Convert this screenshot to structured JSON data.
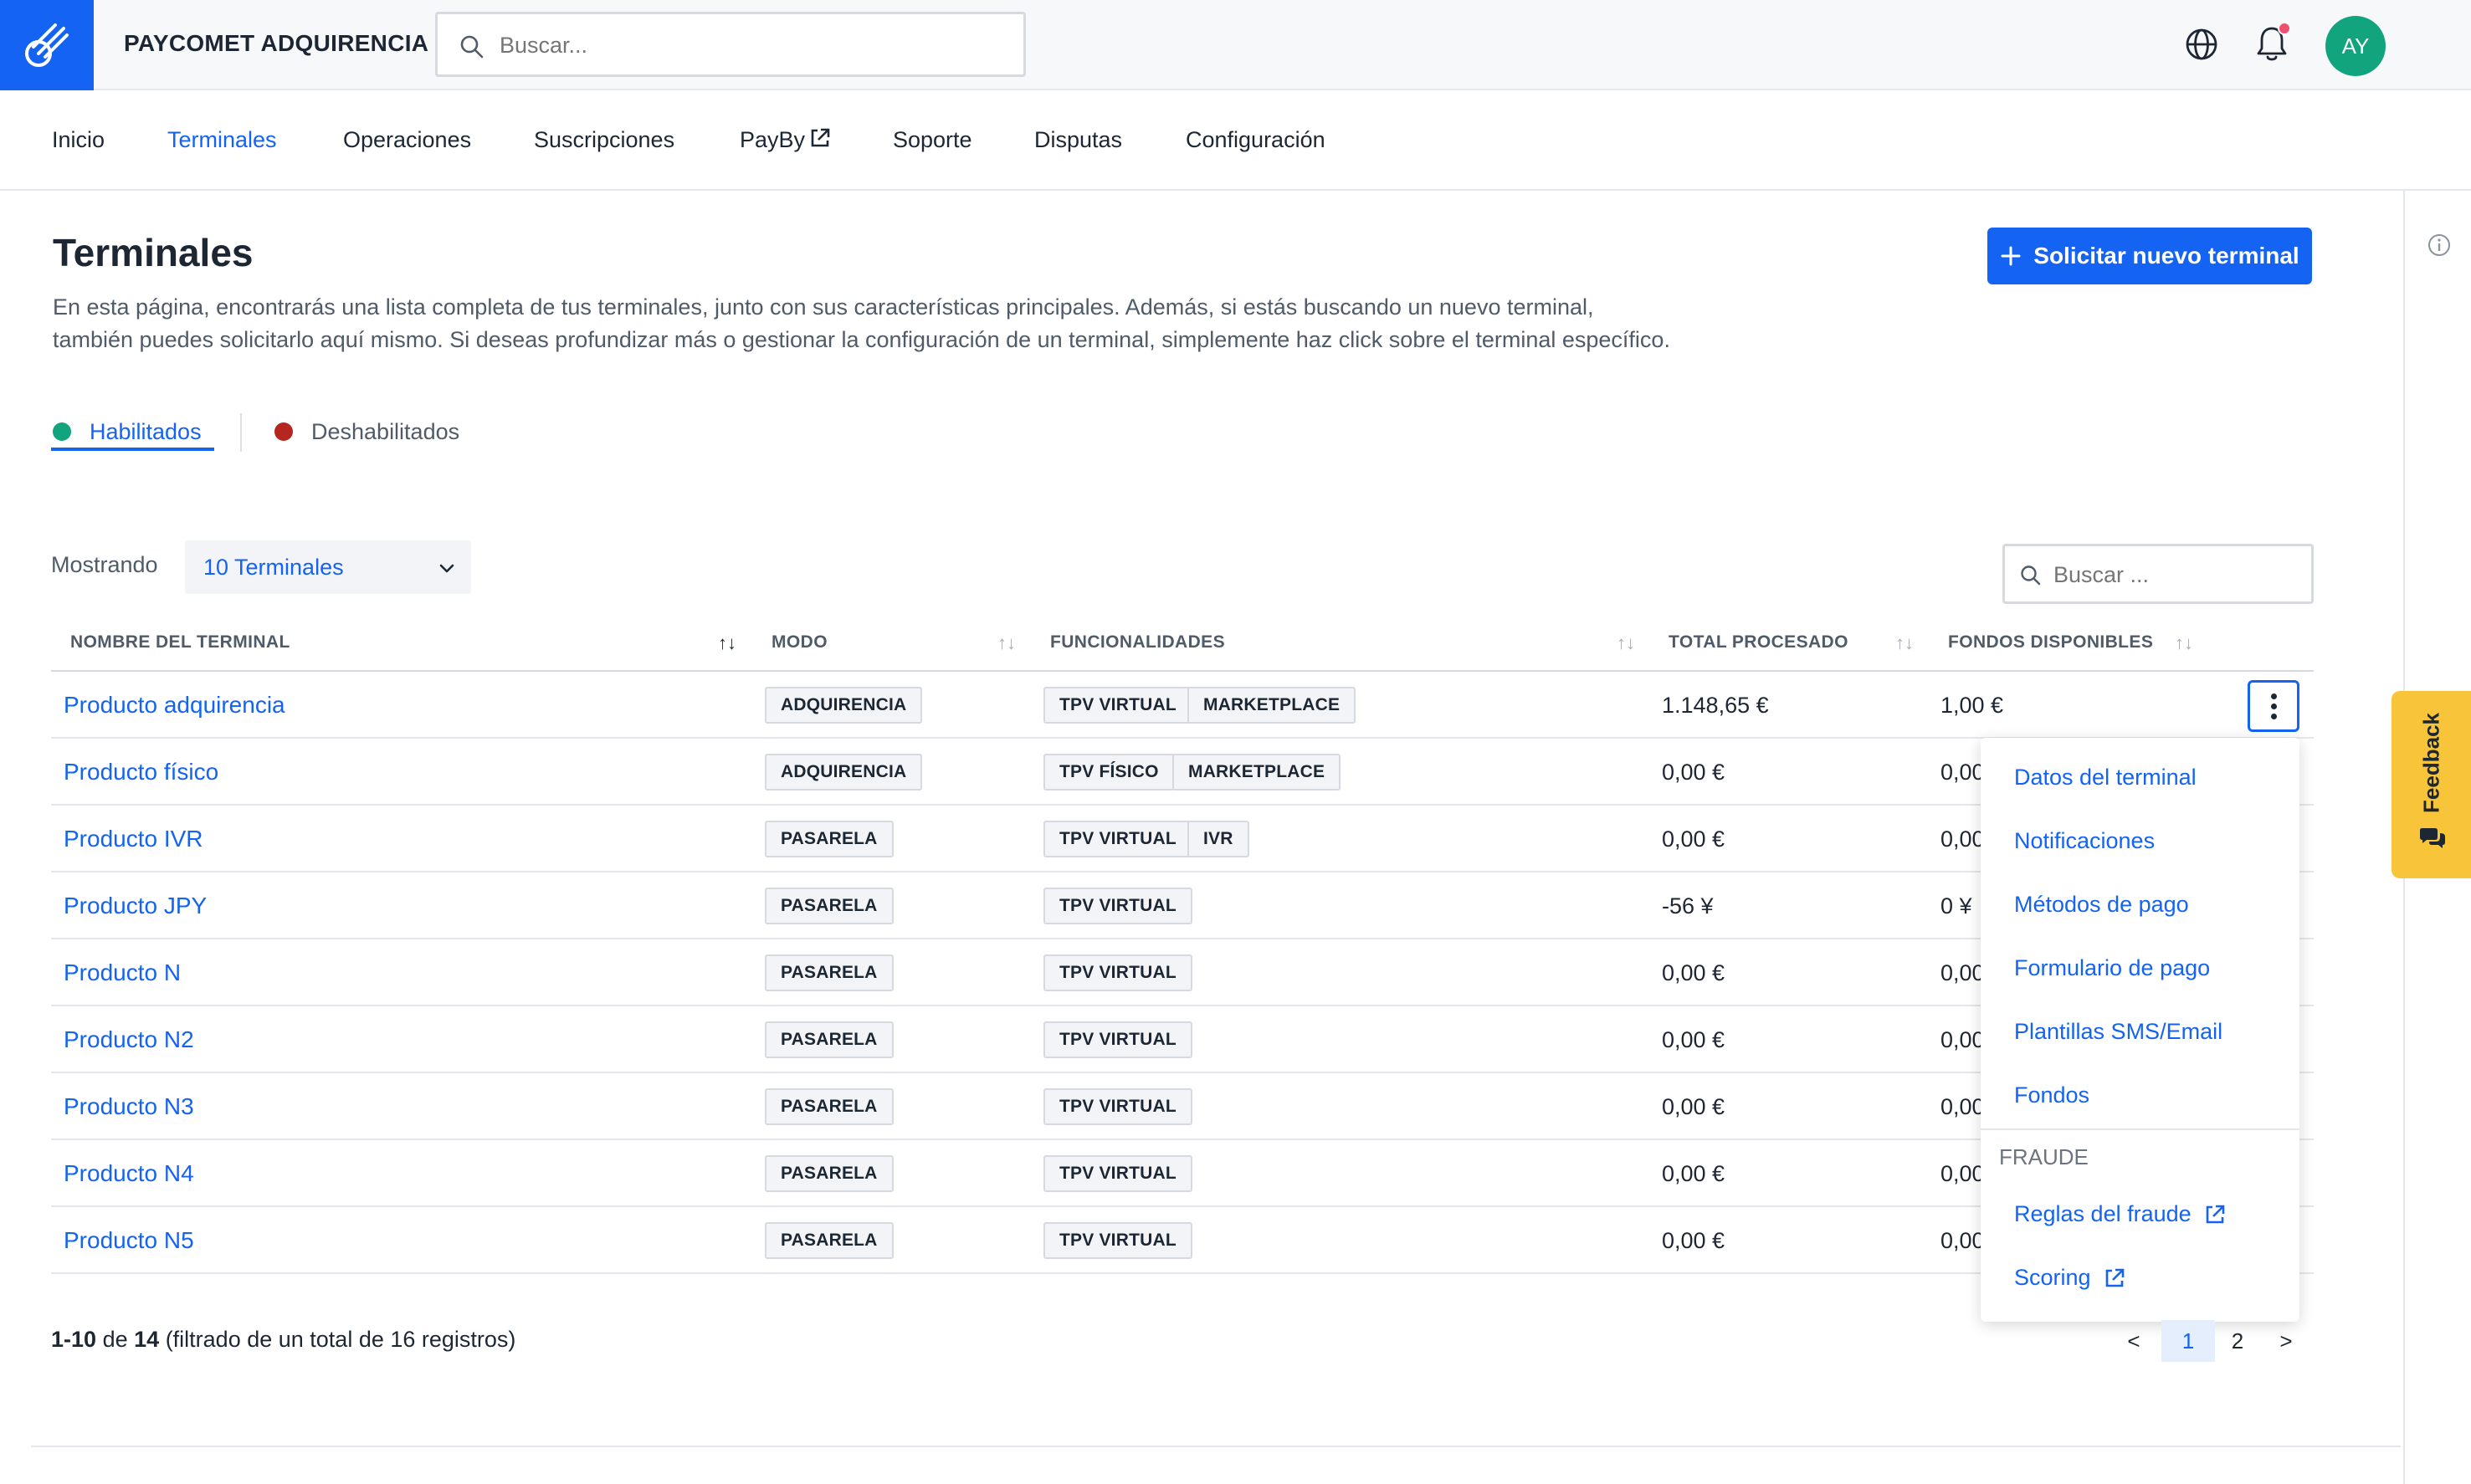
{
  "header": {
    "brand": "PAYCOMET ADQUIRENCIA",
    "search_placeholder": "Buscar...",
    "avatar_initials": "AY"
  },
  "nav": {
    "items": [
      {
        "label": "Inicio"
      },
      {
        "label": "Terminales"
      },
      {
        "label": "Operaciones"
      },
      {
        "label": "Suscripciones"
      },
      {
        "label": "PayBy"
      },
      {
        "label": "Soporte"
      },
      {
        "label": "Disputas"
      },
      {
        "label": "Configuración"
      }
    ],
    "active": "Terminales"
  },
  "page": {
    "title": "Terminales",
    "description_line1": "En esta página, encontrarás una lista completa de tus terminales, junto con sus características principales. Además, si estás buscando un nuevo terminal,",
    "description_line2": "también puedes solicitarlo aquí mismo. Si deseas profundizar más o gestionar la configuración de un terminal, simplemente haz click sobre el terminal específico.",
    "new_terminal_label": "Solicitar nuevo terminal"
  },
  "tabs": {
    "enabled_label": "Habilitados",
    "disabled_label": "Deshabilitados",
    "enabled_color": "#12a57d",
    "disabled_color": "#b4261f"
  },
  "controls": {
    "showing_label": "Mostrando",
    "showing_value": "10 Terminales",
    "table_search_placeholder": "Buscar ..."
  },
  "table": {
    "columns": [
      "NOMBRE DEL TERMINAL",
      "MODO",
      "FUNCIONALIDADES",
      "TOTAL PROCESADO",
      "FONDOS DISPONIBLES"
    ],
    "rows": [
      {
        "name": "Producto adquirencia",
        "mode": "ADQUIRENCIA",
        "features": [
          "TPV VIRTUAL",
          "MARKETPLACE"
        ],
        "total": "1.148,65 €",
        "funds": "1,00 €"
      },
      {
        "name": "Producto físico",
        "mode": "ADQUIRENCIA",
        "features": [
          "TPV FÍSICO",
          "MARKETPLACE"
        ],
        "total": "0,00 €",
        "funds": "0,00"
      },
      {
        "name": "Producto IVR",
        "mode": "PASARELA",
        "features": [
          "TPV VIRTUAL",
          "IVR"
        ],
        "total": "0,00 €",
        "funds": "0,00"
      },
      {
        "name": "Producto JPY",
        "mode": "PASARELA",
        "features": [
          "TPV VIRTUAL"
        ],
        "total": "-56 ¥",
        "funds": "0 ¥"
      },
      {
        "name": "Producto N",
        "mode": "PASARELA",
        "features": [
          "TPV VIRTUAL"
        ],
        "total": "0,00 €",
        "funds": "0,00"
      },
      {
        "name": "Producto N2",
        "mode": "PASARELA",
        "features": [
          "TPV VIRTUAL"
        ],
        "total": "0,00 €",
        "funds": "0,00"
      },
      {
        "name": "Producto N3",
        "mode": "PASARELA",
        "features": [
          "TPV VIRTUAL"
        ],
        "total": "0,00 €",
        "funds": "0,00"
      },
      {
        "name": "Producto N4",
        "mode": "PASARELA",
        "features": [
          "TPV VIRTUAL"
        ],
        "total": "0,00 €",
        "funds": "0,00"
      },
      {
        "name": "Producto N5",
        "mode": "PASARELA",
        "features": [
          "TPV VIRTUAL"
        ],
        "total": "0,00 €",
        "funds": "0,00"
      }
    ]
  },
  "dropdown": {
    "items": [
      "Datos del terminal",
      "Notificaciones",
      "Métodos de pago",
      "Formulario de pago",
      "Plantillas SMS/Email",
      "Fondos"
    ],
    "section_label": "FRAUDE",
    "fraud_items": [
      "Reglas del fraude",
      "Scoring"
    ]
  },
  "footer": {
    "range": "1-10",
    "of_label": "de",
    "count": "14",
    "filter_text": "(filtrado de un total de 16 registros)",
    "pages": [
      "<",
      "1",
      "2",
      ">"
    ],
    "current_page": "1"
  },
  "feedback": {
    "label": "Feedback"
  },
  "colors": {
    "accent": "#1463f3",
    "feedback": "#f8c43a",
    "avatar": "#12a57d"
  }
}
